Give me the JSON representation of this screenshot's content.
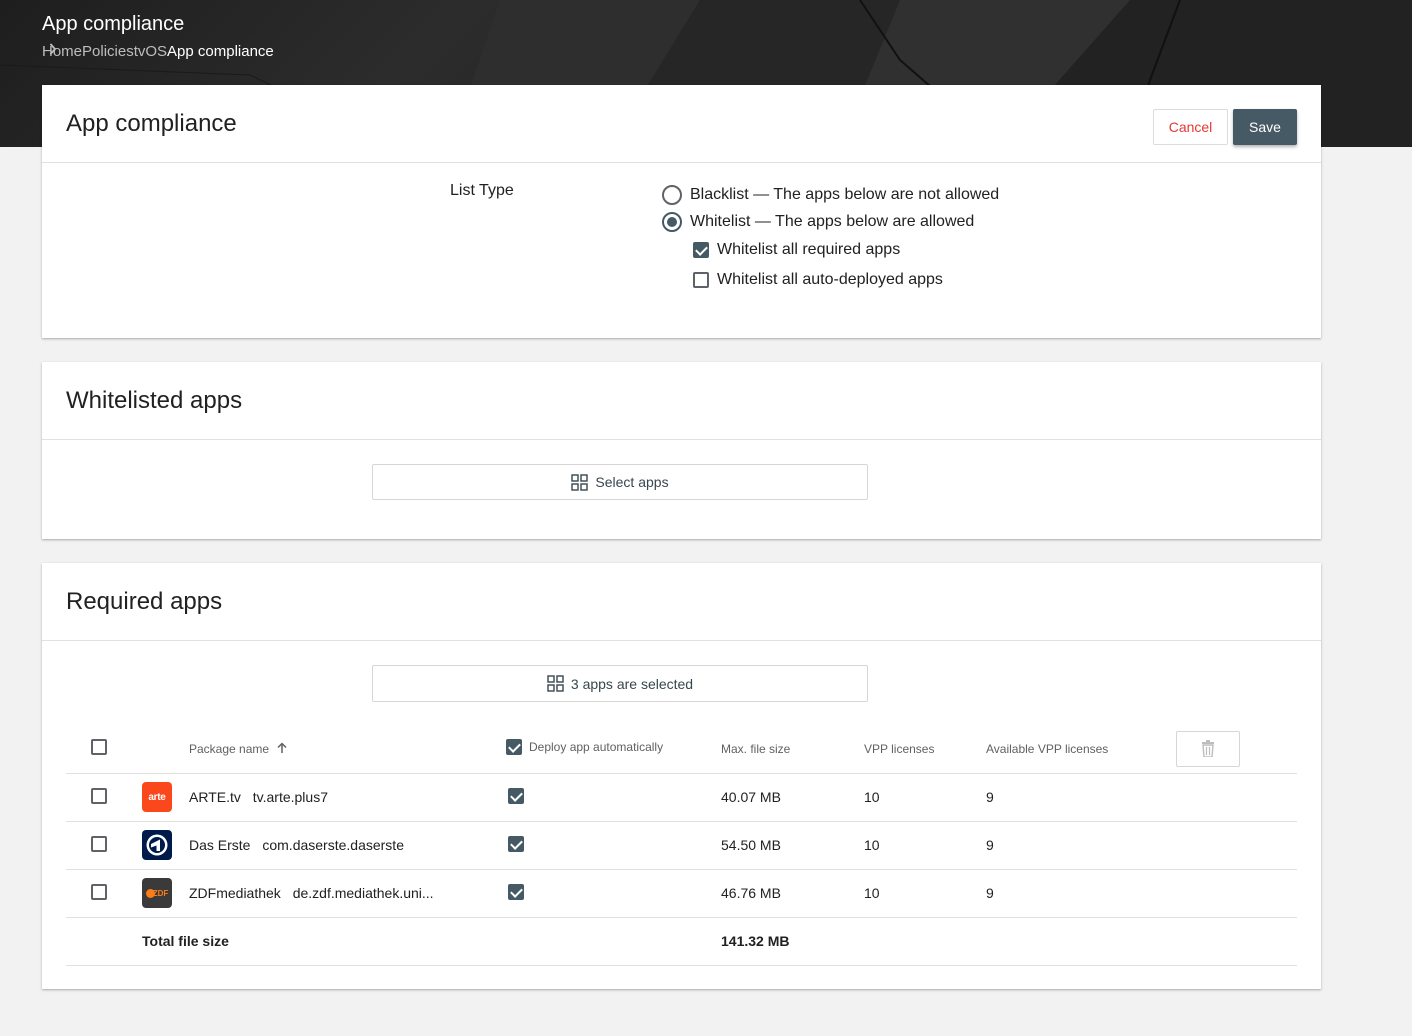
{
  "header": {
    "title": "App compliance",
    "breadcrumb": [
      "Home",
      "Policies",
      "tvOS",
      "App compliance"
    ]
  },
  "compliance_card": {
    "title": "App compliance",
    "cancel_label": "Cancel",
    "save_label": "Save",
    "list_type_label": "List Type",
    "options": {
      "blacklist": {
        "label": "Blacklist — The apps below are not allowed",
        "selected": false
      },
      "whitelist": {
        "label": "Whitelist — The apps below are allowed",
        "selected": true
      }
    },
    "checkboxes": {
      "required": {
        "label": "Whitelist all required apps",
        "checked": true
      },
      "auto_deployed": {
        "label": "Whitelist all auto-deployed apps",
        "checked": false
      }
    }
  },
  "whitelisted_card": {
    "title": "Whitelisted apps",
    "select_label": "Select apps"
  },
  "required_card": {
    "title": "Required apps",
    "select_label": "3 apps are selected",
    "columns": {
      "package_name": "Package name",
      "deploy": "Deploy app automatically",
      "max_size": "Max. file size",
      "vpp": "VPP licenses",
      "available_vpp": "Available VPP licenses"
    },
    "rows": [
      {
        "name": "ARTE.tv",
        "package": "tv.arte.plus7",
        "icon": "arte-icon",
        "deploy": true,
        "size": "40.07 MB",
        "vpp": "10",
        "available": "9"
      },
      {
        "name": "Das Erste",
        "package": "com.daserste.daserste",
        "icon": "das-erste-icon",
        "deploy": true,
        "size": "54.50 MB",
        "vpp": "10",
        "available": "9"
      },
      {
        "name": "ZDFmediathek",
        "package": "de.zdf.mediathek.uni...",
        "icon": "zdf-icon",
        "deploy": true,
        "size": "46.76 MB",
        "vpp": "10",
        "available": "9"
      }
    ],
    "total_label": "Total file size",
    "total_size": "141.32 MB"
  },
  "icons": {
    "arte_text": "arte",
    "zdf_text": "ZDF"
  },
  "colors": {
    "accent": "#455a64",
    "cancel": "#e53935",
    "arte": "#fa481c",
    "das_erste": "#001a4b",
    "zdf": "#3a3a3a"
  }
}
